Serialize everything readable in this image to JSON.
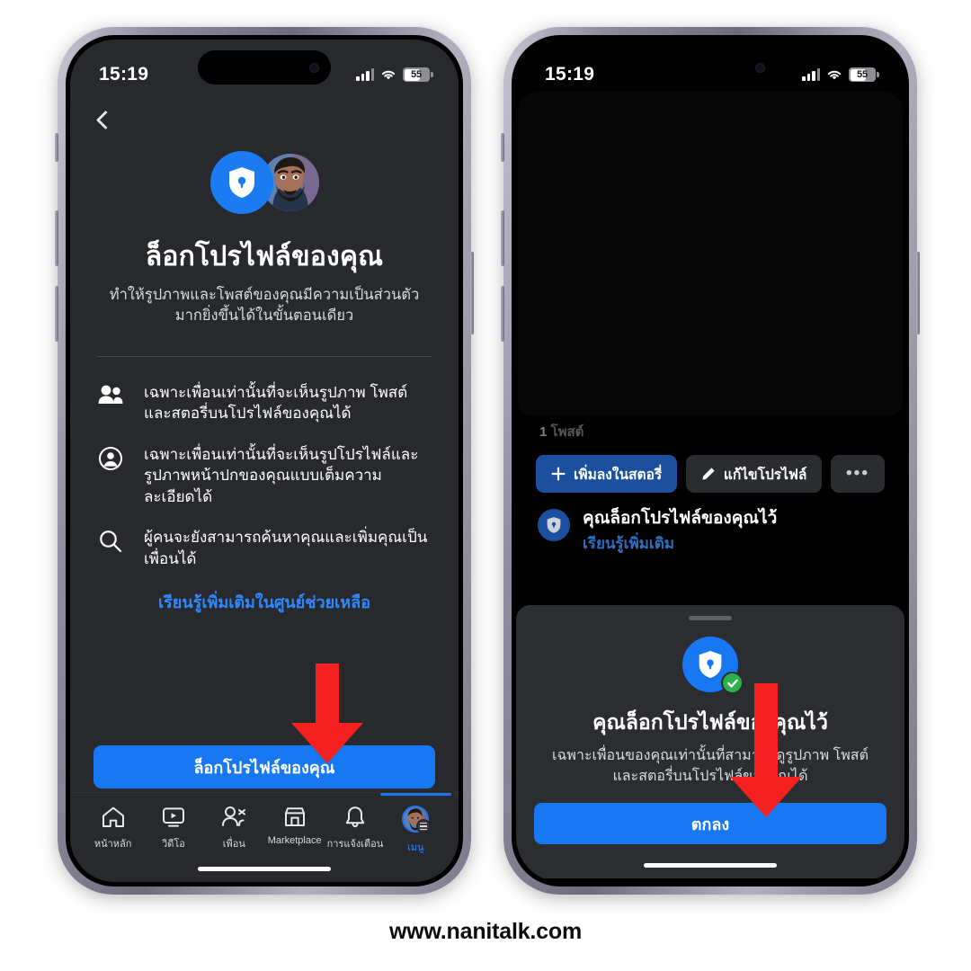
{
  "watermark": "www.nanitalk.com",
  "colors": {
    "facebook_blue": "#1877f2",
    "link_blue": "#2e89ff",
    "arrow_red": "#f52020",
    "check_green": "#2bb24c",
    "screen_bg_1": "#27292c",
    "screen_bg_2": "#000000",
    "sheet_bg": "#2b2d31"
  },
  "status_bar": {
    "time": "15:19",
    "battery_percent": "55",
    "icons": [
      "cellular-signal-icon",
      "wifi-icon",
      "battery-icon"
    ]
  },
  "phone1": {
    "back_button_icon": "chevron-left-icon",
    "hero": {
      "shield_icon": "shield-lock-icon",
      "avatar": "profile-avatar"
    },
    "title": "ล็อกโปรไฟล์ของคุณ",
    "subtitle": "ทำให้รูปภาพและโพสต์ของคุณมีความเป็นส่วนตัวมากยิ่งขึ้นได้ในขั้นตอนเดียว",
    "bullets": [
      {
        "icon": "people-icon",
        "text": "เฉพาะเพื่อนเท่านั้นที่จะเห็นรูปภาพ โพสต์ และสตอรี่บนโปรไฟล์ของคุณได้"
      },
      {
        "icon": "account-circle-icon",
        "text": "เฉพาะเพื่อนเท่านั้นที่จะเห็นรูปโปรไฟล์และรูปภาพหน้าปกของคุณแบบเต็มความละเอียดได้"
      },
      {
        "icon": "search-icon",
        "text": "ผู้คนจะยังสามารถค้นหาคุณและเพิ่มคุณเป็นเพื่อนได้"
      }
    ],
    "help_link": "เรียนรู้เพิ่มเติมในศูนย์ช่วยเหลือ",
    "cta_button": "ล็อกโปรไฟล์ของคุณ",
    "tabs": [
      {
        "icon": "home-icon",
        "label": "หน้าหลัก",
        "active": false
      },
      {
        "icon": "video-icon",
        "label": "วิดีโอ",
        "active": false
      },
      {
        "icon": "friends-icon",
        "label": "เพื่อน",
        "active": false
      },
      {
        "icon": "marketplace-icon",
        "label": "Marketplace",
        "active": false
      },
      {
        "icon": "bell-icon",
        "label": "การแจ้งเตือน",
        "active": false
      },
      {
        "icon": "menu-avatar-icon",
        "label": "เมนู",
        "active": true
      }
    ]
  },
  "phone2": {
    "cover_photo": "profile-cover-photo",
    "posts_count_number": "1",
    "posts_count_label": "โพสต์",
    "actions": [
      {
        "icon": "plus-icon",
        "label": "เพิ่มลงในสตอรี่",
        "style": "primary"
      },
      {
        "icon": "pencil-icon",
        "label": "แก้ไขโปรไฟล์",
        "style": "secondary"
      },
      {
        "icon": "ellipsis-icon",
        "label": "•••",
        "style": "more"
      }
    ],
    "lock_notice": {
      "icon": "shield-lock-icon",
      "title": "คุณล็อกโปรไฟล์ของคุณไว้",
      "link": "เรียนรู้เพิ่มเติม"
    },
    "sheet": {
      "shield_icon": "shield-lock-icon",
      "check_icon": "check-circle-icon",
      "title": "คุณล็อกโปรไฟล์ของคุณไว้",
      "subtitle": "เฉพาะเพื่อนของคุณเท่านั้นที่สามารถดูรูปภาพ โพสต์ และสตอรี่บนโปรไฟล์ของคุณได้",
      "confirm_button": "ตกลง"
    }
  },
  "annotations": [
    {
      "name": "arrow-to-lock-profile-button",
      "icon": "arrow-down-icon"
    },
    {
      "name": "arrow-to-confirm-button",
      "icon": "arrow-down-icon"
    }
  ]
}
